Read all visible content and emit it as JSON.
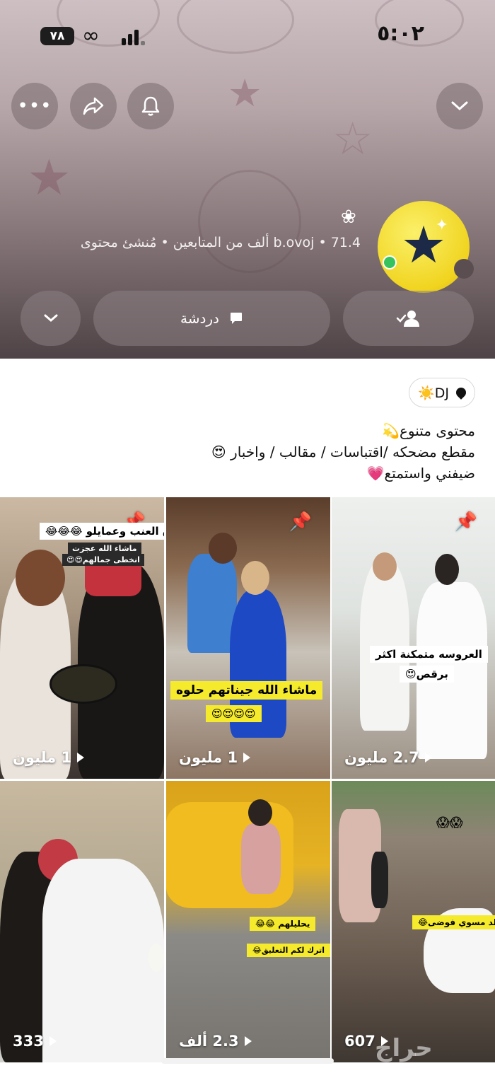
{
  "status_bar": {
    "time": "٥:٠٢",
    "battery": "٧٨"
  },
  "header": {
    "buttons": [
      "more-options",
      "share",
      "notifications",
      "collapse"
    ],
    "profile_meta": "b.ovoj • 71.4 ألف من المتابعين • مُنشئ محتوى",
    "chat_label": "دردشة"
  },
  "bio": {
    "location_chip": "DJ☀️",
    "lines": [
      "محتوى متنوع💫",
      "مقطع مضحكه /اقتباسات  / مقالب / واخبار 😍",
      "ضيفني واستمتع💗"
    ]
  },
  "videos": [
    {
      "views": "1 مليون",
      "caption_top": "ورق العنب وعمايلو 😂😂😂",
      "caption_mid": "ماشاء الله عجزت",
      "caption_low": "انخطى جمالهم😍😍",
      "pinned": true
    },
    {
      "views": "1 مليون",
      "caption_main": "ماشاء الله جيناتهم حلوه",
      "caption_emoji": "😍😍😍😍",
      "pinned": true
    },
    {
      "views": "2.7 مليون",
      "caption_main": "العروسه متمكنة اكثر",
      "caption_sub": "برقص😍",
      "pinned": true
    },
    {
      "views": "333",
      "pinned": false
    },
    {
      "views": "2.3 ألف",
      "caption_main": "يحليلهم 😂😂",
      "caption_sub": "اترك لكم التعليق😂",
      "pinned": false
    },
    {
      "views": "607",
      "caption_top": "😱😱",
      "caption_main": "الولد مسوي فوضى😂",
      "pinned": false
    }
  ],
  "watermark": "حراج",
  "colors": {
    "accent_yellow": "#f0d41f",
    "online": "#36c25d",
    "caption_yellow": "#f5ea2c"
  }
}
